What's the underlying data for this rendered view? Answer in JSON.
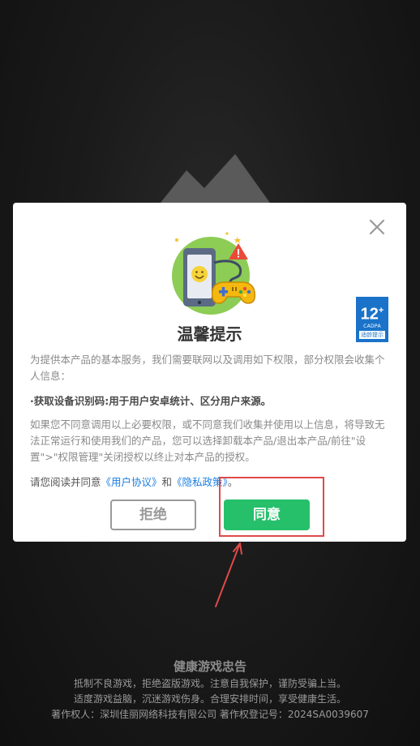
{
  "dialog": {
    "title": "温馨提示",
    "paragraph1": "为提供本产品的基本服务，我们需要联网以及调用如下权限，部分权限会收集个人信息：",
    "paragraph2": "·获取设备识别码:用于用户安卓统计、区分用户来源。",
    "paragraph3": "如果您不同意调用以上必要权限，或不同意我们收集并使用以上信息，将导致无法正常运行和使用我们的产品，您可以选择卸载本产品/退出本产品/前往\"设置\">\"权限管理\"关闭授权以终止对本产品的授权。",
    "consent_prefix": "请您阅读并同意",
    "user_agreement": "《用户协议》",
    "consent_and": "和",
    "privacy_policy": "《隐私政策》",
    "consent_suffix": "。",
    "reject_label": "拒绝",
    "agree_label": "同意",
    "close_icon": "close-icon",
    "illustration_icon": "phone-gamepad-icon"
  },
  "age_rating": {
    "age": "12",
    "plus": "+",
    "org": "CADPA",
    "tip": "适龄提示"
  },
  "footer": {
    "title": "健康游戏忠告",
    "line1": "抵制不良游戏，拒绝盗版游戏。注意自我保护，谨防受骗上当。",
    "line2": "适度游戏益脑，沉迷游戏伤身。合理安排时间，享受健康生活。",
    "line3": "著作权人：深圳佳丽网络科技有限公司   著作权登记号：2024SA0039607"
  },
  "colors": {
    "agree": "#26c06b",
    "link": "#1b7ee0",
    "annotation": "#e04a4a",
    "age_badge": "#1a73c9"
  }
}
